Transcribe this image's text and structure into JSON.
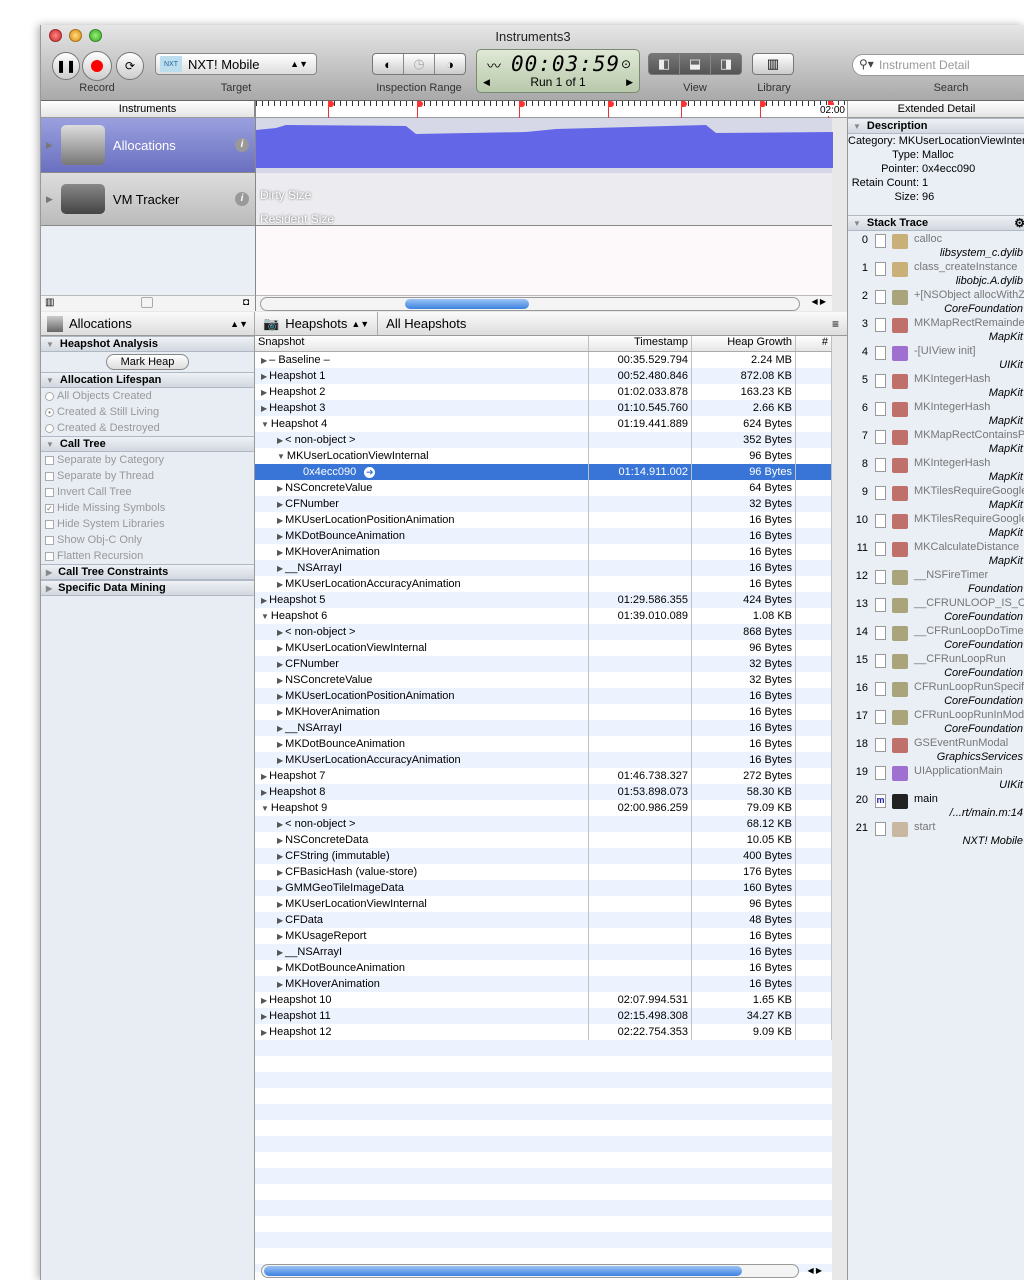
{
  "window": {
    "title": "Instruments3"
  },
  "toolbar": {
    "record_label": "Record",
    "target_label": "Target",
    "target_value": "NXT! Mobile",
    "target_icon_text": "NXT",
    "inspection_label": "Inspection Range",
    "time": "00:03:59",
    "run": "Run 1 of 1",
    "view_label": "View",
    "library_label": "Library",
    "search_label": "Search",
    "search_placeholder": "Instrument Detail"
  },
  "headers": {
    "instruments": "Instruments",
    "ruler_end": "02:00",
    "extended": "Extended Detail"
  },
  "tracks": [
    {
      "name": "Allocations",
      "color": "#6466e8"
    },
    {
      "name": "VM Tracker",
      "labels": [
        "Dirty Size",
        "Resident Size"
      ]
    }
  ],
  "nav": {
    "instrument": "Allocations",
    "view": "Heapshots",
    "crumb": "All Heapshots"
  },
  "left": {
    "heapshot_title": "Heapshot Analysis",
    "mark_heap": "Mark Heap",
    "lifespan_title": "Allocation Lifespan",
    "lifespan": [
      {
        "label": "All Objects Created",
        "selected": false
      },
      {
        "label": "Created & Still Living",
        "selected": true
      },
      {
        "label": "Created & Destroyed",
        "selected": false
      }
    ],
    "calltree_title": "Call Tree",
    "calltree": [
      {
        "label": "Separate by Category",
        "checked": false
      },
      {
        "label": "Separate by Thread",
        "checked": false
      },
      {
        "label": "Invert Call Tree",
        "checked": false
      },
      {
        "label": "Hide Missing Symbols",
        "checked": true
      },
      {
        "label": "Hide System Libraries",
        "checked": false
      },
      {
        "label": "Show Obj-C Only",
        "checked": false
      },
      {
        "label": "Flatten Recursion",
        "checked": false
      }
    ],
    "constraints_title": "Call Tree Constraints",
    "mining_title": "Specific Data Mining"
  },
  "table": {
    "columns": [
      "Snapshot",
      "Timestamp",
      "Heap Growth",
      "#"
    ],
    "rows": [
      {
        "l": 0,
        "s": "– Baseline –",
        "t": "00:35.529.794",
        "g": "2.24 MB",
        "o": 0
      },
      {
        "l": 0,
        "s": "Heapshot 1",
        "t": "00:52.480.846",
        "g": "872.08 KB",
        "o": 0
      },
      {
        "l": 0,
        "s": "Heapshot 2",
        "t": "01:02.033.878",
        "g": "163.23 KB",
        "o": 0
      },
      {
        "l": 0,
        "s": "Heapshot 3",
        "t": "01:10.545.760",
        "g": "2.66 KB",
        "o": 0
      },
      {
        "l": 0,
        "s": "Heapshot 4",
        "t": "01:19.441.889",
        "g": "624 Bytes",
        "o": 1
      },
      {
        "l": 1,
        "s": "< non-object >",
        "t": "",
        "g": "352 Bytes",
        "o": 0
      },
      {
        "l": 1,
        "s": "MKUserLocationViewInternal",
        "t": "",
        "g": "96 Bytes",
        "o": 1
      },
      {
        "l": 2,
        "s": "0x4ecc090",
        "t": "01:14.911.002",
        "g": "96 Bytes",
        "sel": true
      },
      {
        "l": 1,
        "s": "NSConcreteValue",
        "t": "",
        "g": "64 Bytes",
        "o": 0
      },
      {
        "l": 1,
        "s": "CFNumber",
        "t": "",
        "g": "32 Bytes",
        "o": 0
      },
      {
        "l": 1,
        "s": "MKUserLocationPositionAnimation",
        "t": "",
        "g": "16 Bytes",
        "o": 0
      },
      {
        "l": 1,
        "s": "MKDotBounceAnimation",
        "t": "",
        "g": "16 Bytes",
        "o": 0
      },
      {
        "l": 1,
        "s": "MKHoverAnimation",
        "t": "",
        "g": "16 Bytes",
        "o": 0
      },
      {
        "l": 1,
        "s": "__NSArrayI",
        "t": "",
        "g": "16 Bytes",
        "o": 0
      },
      {
        "l": 1,
        "s": "MKUserLocationAccuracyAnimation",
        "t": "",
        "g": "16 Bytes",
        "o": 0
      },
      {
        "l": 0,
        "s": "Heapshot 5",
        "t": "01:29.586.355",
        "g": "424 Bytes",
        "o": 0
      },
      {
        "l": 0,
        "s": "Heapshot 6",
        "t": "01:39.010.089",
        "g": "1.08 KB",
        "o": 1
      },
      {
        "l": 1,
        "s": "< non-object >",
        "t": "",
        "g": "868 Bytes",
        "o": 0
      },
      {
        "l": 1,
        "s": "MKUserLocationViewInternal",
        "t": "",
        "g": "96 Bytes",
        "o": 0
      },
      {
        "l": 1,
        "s": "CFNumber",
        "t": "",
        "g": "32 Bytes",
        "o": 0
      },
      {
        "l": 1,
        "s": "NSConcreteValue",
        "t": "",
        "g": "32 Bytes",
        "o": 0
      },
      {
        "l": 1,
        "s": "MKUserLocationPositionAnimation",
        "t": "",
        "g": "16 Bytes",
        "o": 0
      },
      {
        "l": 1,
        "s": "MKHoverAnimation",
        "t": "",
        "g": "16 Bytes",
        "o": 0
      },
      {
        "l": 1,
        "s": "__NSArrayI",
        "t": "",
        "g": "16 Bytes",
        "o": 0
      },
      {
        "l": 1,
        "s": "MKDotBounceAnimation",
        "t": "",
        "g": "16 Bytes",
        "o": 0
      },
      {
        "l": 1,
        "s": "MKUserLocationAccuracyAnimation",
        "t": "",
        "g": "16 Bytes",
        "o": 0
      },
      {
        "l": 0,
        "s": "Heapshot 7",
        "t": "01:46.738.327",
        "g": "272 Bytes",
        "o": 0
      },
      {
        "l": 0,
        "s": "Heapshot 8",
        "t": "01:53.898.073",
        "g": "58.30 KB",
        "o": 0
      },
      {
        "l": 0,
        "s": "Heapshot 9",
        "t": "02:00.986.259",
        "g": "79.09 KB",
        "o": 1
      },
      {
        "l": 1,
        "s": "< non-object >",
        "t": "",
        "g": "68.12 KB",
        "o": 0
      },
      {
        "l": 1,
        "s": "NSConcreteData",
        "t": "",
        "g": "10.05 KB",
        "o": 0
      },
      {
        "l": 1,
        "s": "CFString (immutable)",
        "t": "",
        "g": "400 Bytes",
        "o": 0
      },
      {
        "l": 1,
        "s": "CFBasicHash (value-store)",
        "t": "",
        "g": "176 Bytes",
        "o": 0
      },
      {
        "l": 1,
        "s": "GMMGeoTileImageData",
        "t": "",
        "g": "160 Bytes",
        "o": 0
      },
      {
        "l": 1,
        "s": "MKUserLocationViewInternal",
        "t": "",
        "g": "96 Bytes",
        "o": 0
      },
      {
        "l": 1,
        "s": "CFData",
        "t": "",
        "g": "48 Bytes",
        "o": 0
      },
      {
        "l": 1,
        "s": "MKUsageReport",
        "t": "",
        "g": "16 Bytes",
        "o": 0
      },
      {
        "l": 1,
        "s": "__NSArrayI",
        "t": "",
        "g": "16 Bytes",
        "o": 0
      },
      {
        "l": 1,
        "s": "MKDotBounceAnimation",
        "t": "",
        "g": "16 Bytes",
        "o": 0
      },
      {
        "l": 1,
        "s": "MKHoverAnimation",
        "t": "",
        "g": "16 Bytes",
        "o": 0
      },
      {
        "l": 0,
        "s": "Heapshot 10",
        "t": "02:07.994.531",
        "g": "1.65 KB",
        "o": 0
      },
      {
        "l": 0,
        "s": "Heapshot 11",
        "t": "02:15.498.308",
        "g": "34.27 KB",
        "o": 0
      },
      {
        "l": 0,
        "s": "Heapshot 12",
        "t": "02:22.754.353",
        "g": "9.09 KB",
        "o": 0
      }
    ]
  },
  "extended": {
    "description_title": "Description",
    "description": [
      {
        "k": "Category:",
        "v": "MKUserLocationViewInternal"
      },
      {
        "k": "Type:",
        "v": "Malloc"
      },
      {
        "k": "Pointer:",
        "v": "0x4ecc090"
      },
      {
        "k": "Retain Count:",
        "v": "1"
      },
      {
        "k": "Size:",
        "v": "96"
      }
    ],
    "stack_title": "Stack Trace",
    "stack": [
      {
        "n": "0",
        "sym": "calloc",
        "lib": "libsystem_c.dylib",
        "c": "#c8b078"
      },
      {
        "n": "1",
        "sym": "class_createInstance",
        "lib": "libobjc.A.dylib",
        "c": "#c8b078"
      },
      {
        "n": "2",
        "sym": "+[NSObject allocWithZone:]",
        "lib": "CoreFoundation",
        "c": "#a9a47a"
      },
      {
        "n": "3",
        "sym": "MKMapRectRemainder",
        "lib": "MapKit",
        "c": "#c0706a"
      },
      {
        "n": "4",
        "sym": "-[UIView init]",
        "lib": "UIKit",
        "c": "#a070d0"
      },
      {
        "n": "5",
        "sym": "MKIntegerHash",
        "lib": "MapKit",
        "c": "#c0706a"
      },
      {
        "n": "6",
        "sym": "MKIntegerHash",
        "lib": "MapKit",
        "c": "#c0706a"
      },
      {
        "n": "7",
        "sym": "MKMapRectContainsPoint",
        "lib": "MapKit",
        "c": "#c0706a"
      },
      {
        "n": "8",
        "sym": "MKIntegerHash",
        "lib": "MapKit",
        "c": "#c0706a"
      },
      {
        "n": "9",
        "sym": "MKTilesRequireGoogleLegalNotices",
        "lib": "MapKit",
        "c": "#c0706a"
      },
      {
        "n": "10",
        "sym": "MKTilesRequireGoogleLegalNotices",
        "lib": "MapKit",
        "c": "#c0706a"
      },
      {
        "n": "11",
        "sym": "MKCalculateDistance",
        "lib": "MapKit",
        "c": "#c0706a"
      },
      {
        "n": "12",
        "sym": "__NSFireTimer",
        "lib": "Foundation",
        "c": "#a9a47a"
      },
      {
        "n": "13",
        "sym": "__CFRUNLOOP_IS_CALLING_OUT_TO_A_TIMER_CALLBACK_FUNCTION__",
        "lib": "CoreFoundation",
        "c": "#a9a47a"
      },
      {
        "n": "14",
        "sym": "__CFRunLoopDoTimer",
        "lib": "CoreFoundation",
        "c": "#a9a47a"
      },
      {
        "n": "15",
        "sym": "__CFRunLoopRun",
        "lib": "CoreFoundation",
        "c": "#a9a47a"
      },
      {
        "n": "16",
        "sym": "CFRunLoopRunSpecific",
        "lib": "CoreFoundation",
        "c": "#a9a47a"
      },
      {
        "n": "17",
        "sym": "CFRunLoopRunInMode",
        "lib": "CoreFoundation",
        "c": "#a9a47a"
      },
      {
        "n": "18",
        "sym": "GSEventRunModal",
        "lib": "GraphicsServices",
        "c": "#c0706a"
      },
      {
        "n": "19",
        "sym": "UIApplicationMain",
        "lib": "UIKit",
        "c": "#a070d0"
      },
      {
        "n": "20",
        "sym": "main",
        "lib": "/...rt/main.m:14",
        "c": "#222",
        "user": true
      },
      {
        "n": "21",
        "sym": "start",
        "lib": "NXT! Mobile",
        "c": "#c8b8a0"
      }
    ]
  }
}
